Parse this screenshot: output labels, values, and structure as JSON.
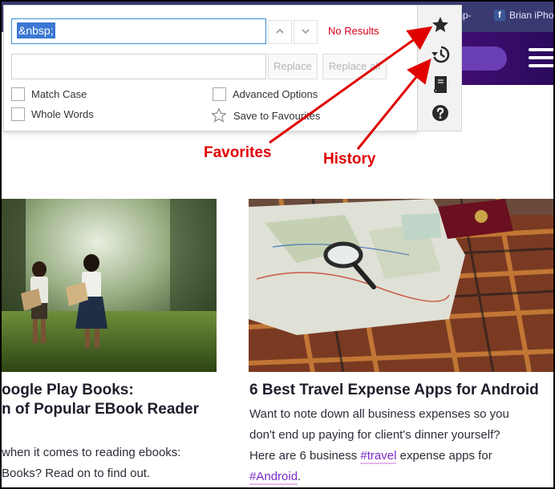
{
  "browser": {
    "tab_fragment": "mp-",
    "facebook_text": "Brian iPhon"
  },
  "find_panel": {
    "find_value": "&nbsp;",
    "status": "No Results",
    "replace_value": "",
    "replace_label": "Replace",
    "replace_all_label": "Replace all",
    "options": {
      "match_case": "Match Case",
      "whole_words": "Whole Words",
      "advanced_options": "Advanced Options",
      "save_to_favourites": "Save to Favourites"
    }
  },
  "toolbar": {
    "icons": [
      "star-icon",
      "history-icon",
      "book-icon",
      "help-icon"
    ]
  },
  "annotations": {
    "favorites": "Favorites",
    "history": "History"
  },
  "articles": [
    {
      "title_line1": "oogle Play Books:",
      "title_line2": "n of Popular EBook Reader",
      "text_line1": " when it comes to reading ebooks:",
      "text_line2": "Books? Read on to find out."
    },
    {
      "title": "6 Best Travel Expense Apps for Android",
      "text_line1": "Want to note down all business expenses so you",
      "text_line2": "don't end up paying for client's dinner yourself?",
      "text_line3_pre": "Here are 6 business ",
      "tag_travel": "#travel",
      "text_line3_post": " expense apps for",
      "tag_android": "#Android",
      "text_line4_post": "."
    }
  ],
  "colors": {
    "annotation_red": "#e00000",
    "status_red": "#d9001b",
    "site_purple": "#4a0f7a",
    "tag_purple": "#7a2ac9"
  }
}
